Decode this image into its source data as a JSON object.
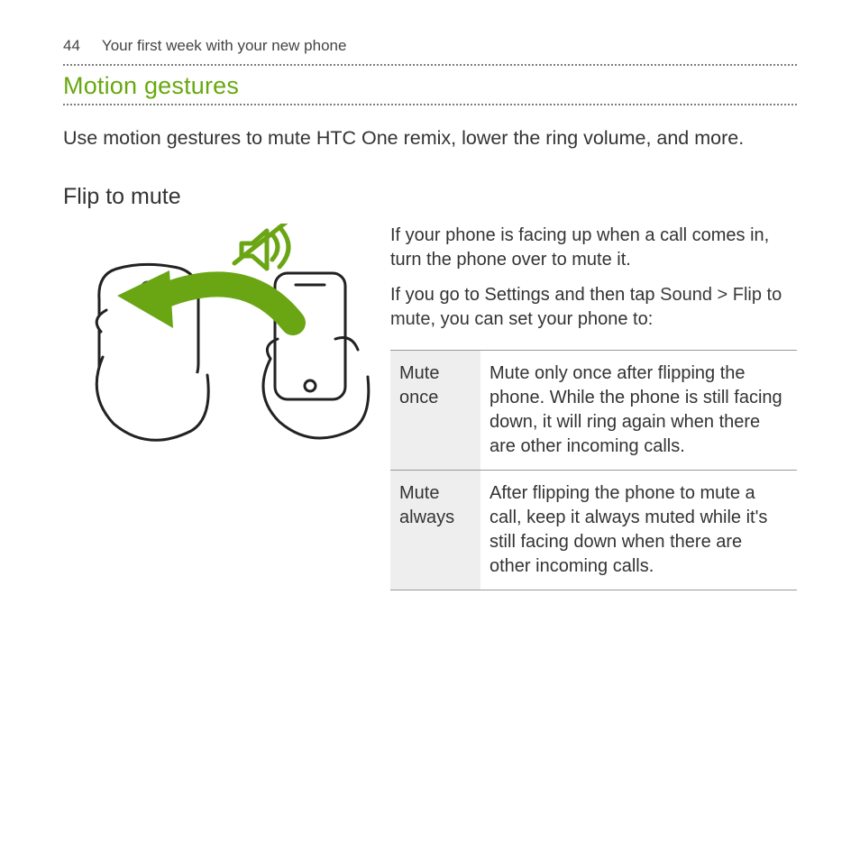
{
  "header": {
    "page_number": "44",
    "chapter": "Your first week with your new phone"
  },
  "section": {
    "title": "Motion gestures",
    "intro": "Use motion gestures to mute HTC One remix, lower the ring volume, and more."
  },
  "feature": {
    "heading": "Flip to mute",
    "p1": "If your phone is facing up when a call comes in, turn the phone over to mute it.",
    "p2_pre": "If you go to Settings and then tap ",
    "p2_path": "Sound > Flip to mute",
    "p2_post": ", you can set your phone to:",
    "options": [
      {
        "key": "Mute once",
        "desc": "Mute only once after flipping the phone. While the phone is still facing down, it will ring again when there are other incoming calls."
      },
      {
        "key": "Mute always",
        "desc": "After flipping the phone to mute a call, keep it always muted while it's still facing down when there are other incoming calls."
      }
    ]
  }
}
